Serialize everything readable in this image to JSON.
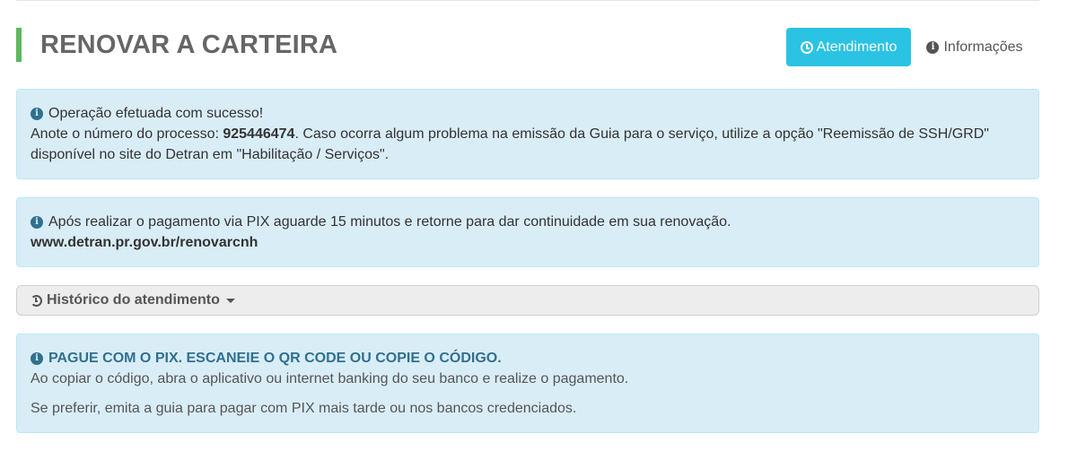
{
  "header": {
    "title": "RENOVAR A CARTEIRA",
    "btn_atendimento": "Atendimento",
    "btn_informacoes": "Informações",
    "accent_color": "#5cb85c",
    "button_color": "#2bc3e3"
  },
  "alert_success": {
    "title": "Operação efetuada com sucesso!",
    "text_prefix": "Anote o número do processo: ",
    "process_number": "925446474",
    "text_suffix": ". Caso ocorra algum problema na emissão da Guia para o serviço, utilize a opção \"Reemissão de SSH/GRD\"",
    "text_line2": "disponível no site do Detran em \"Habilitação / Serviços\"."
  },
  "alert_pix_wait": {
    "text": "Após realizar o pagamento via PIX aguarde 15 minutos e retorne para dar continuidade em sua renovação.",
    "url": "www.detran.pr.gov.br/renovarcnh"
  },
  "historico": {
    "label": "Histórico do atendimento"
  },
  "alert_pix": {
    "title": "PAGUE COM O PIX. ESCANEIE O QR CODE OU COPIE O CÓDIGO.",
    "line1": "Ao copiar o código, abra o aplicativo ou internet banking do seu banco e realize o pagamento.",
    "line2": "Se preferir, emita a guia para pagar com PIX mais tarde ou nos bancos credenciados."
  },
  "icons": {
    "clock": "clock-icon",
    "info": "info-circle-icon",
    "history": "history-icon",
    "caret": "caret-down-icon"
  }
}
